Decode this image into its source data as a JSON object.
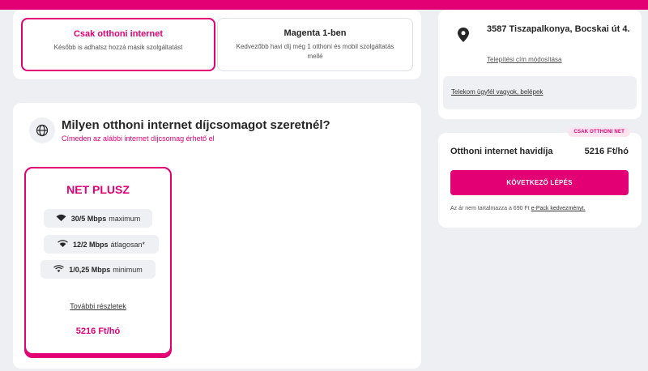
{
  "tabs": [
    {
      "title": "Csak otthoni internet",
      "subtitle": "Később is adhatsz hozzá másik szolgáltatást"
    },
    {
      "title": "Magenta 1-ben",
      "subtitle": "Kedvezőbb havi díj még 1 otthoni és mobil szolgáltatás mellé"
    }
  ],
  "packages": {
    "title": "Milyen otthoni internet díjcsomagot szeretnél?",
    "subtitle": "Címeden az alábbi internet díjcsomag érhető el",
    "plan": {
      "name": "NET PLUSZ",
      "speeds": [
        {
          "value": "30/5 Mbps",
          "label": "maximum"
        },
        {
          "value": "12/2 Mbps",
          "label": "átlagosan*"
        },
        {
          "value": "1/0,25 Mbps",
          "label": "minimum"
        }
      ],
      "details_link": "További részletek",
      "price": "5216 Ft/hó"
    }
  },
  "address": {
    "text": "3587 Tiszapalkonya, Bocskai út 4.",
    "change_link": "Telepítési cím módosítása",
    "login_link": "Telekom ügyfél vagyok, belépek"
  },
  "summary": {
    "badge": "CSAK OTTHONI NET",
    "label": "Otthoni internet havidíja",
    "price": "5216 Ft/hó",
    "next_button": "KÖVETKEZŐ LÉPÉS",
    "note_prefix": "Az ár nem tartalmazza a 690 Ft",
    "note_link": "e-Pack kedvezményt."
  },
  "colors": {
    "brand": "#e20074",
    "background": "#edeff2"
  },
  "icons": [
    "globe-icon",
    "wifi-icon",
    "location-pin-icon"
  ]
}
